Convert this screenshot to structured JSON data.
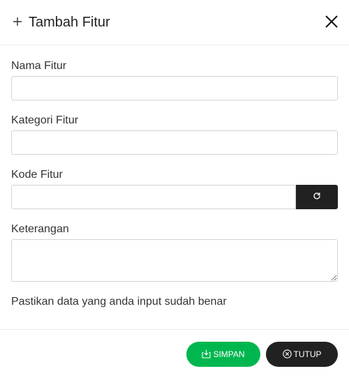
{
  "header": {
    "title": "Tambah Fitur"
  },
  "form": {
    "nama_fitur": {
      "label": "Nama Fitur",
      "value": ""
    },
    "kategori_fitur": {
      "label": "Kategori Fitur",
      "value": ""
    },
    "kode_fitur": {
      "label": "Kode Fitur",
      "value": ""
    },
    "keterangan": {
      "label": "Keterangan",
      "value": ""
    }
  },
  "notice": "Pastikan data yang anda input sudah benar",
  "footer": {
    "save_label": "SIMPAN",
    "close_label": "TUTUP"
  },
  "colors": {
    "save": "#00b74f",
    "dark": "#212121"
  },
  "icons": {
    "header": "plus-icon",
    "close": "close-icon",
    "refresh": "refresh-icon",
    "save": "save-download-icon",
    "tutup": "circle-x-icon"
  }
}
